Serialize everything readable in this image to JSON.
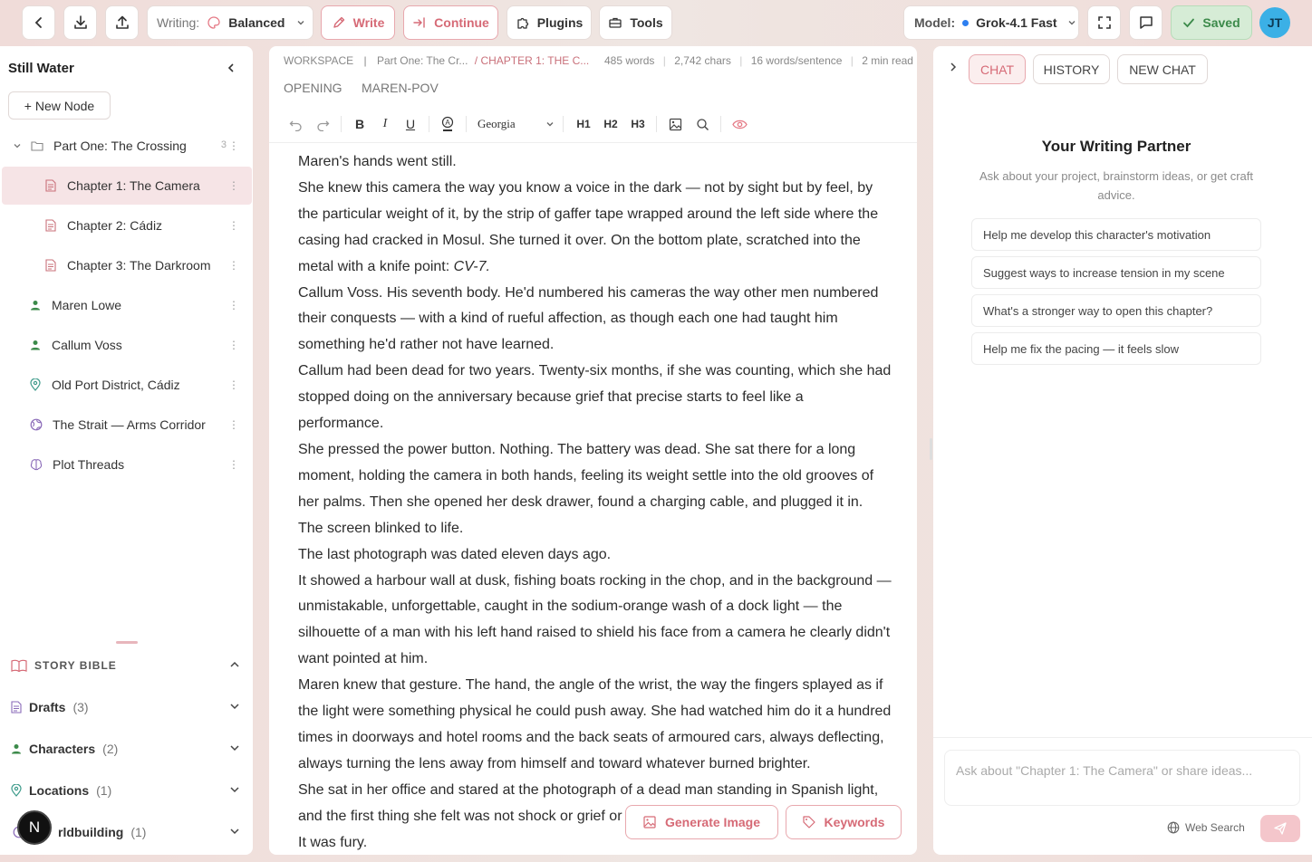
{
  "topbar": {
    "writing_label": "Writing:",
    "writing_mode": "Balanced",
    "write_label": "Write",
    "continue_label": "Continue",
    "plugins_label": "Plugins",
    "tools_label": "Tools",
    "model_label": "Model:",
    "model_value": "Grok-4.1 Fast",
    "saved_label": "Saved",
    "avatar_initials": "JT",
    "accent_color": "#e57a86",
    "saved_color": "#3c8a4a"
  },
  "sidebar": {
    "title": "Still Water",
    "new_node_label": "+ New Node",
    "items": [
      {
        "label": "Part One: The Crossing",
        "count": "3",
        "icon": "folder-icon"
      },
      {
        "label": "Chapter 1: The Camera",
        "icon": "document-icon"
      },
      {
        "label": "Chapter 2: Cádiz",
        "icon": "document-icon"
      },
      {
        "label": "Chapter 3: The Darkroom",
        "icon": "document-icon"
      },
      {
        "label": "Maren Lowe",
        "icon": "person-icon"
      },
      {
        "label": "Callum Voss",
        "icon": "person-icon"
      },
      {
        "label": "Old Port District, Cádiz",
        "icon": "location-pin-icon"
      },
      {
        "label": "The Strait — Arms Corridor",
        "icon": "globe-icon"
      },
      {
        "label": "Plot Threads",
        "icon": "brain-icon"
      }
    ],
    "story_bible": {
      "title": "STORY BIBLE",
      "sections": [
        {
          "label": "Drafts",
          "count": "(3)"
        },
        {
          "label": "Characters",
          "count": "(2)"
        },
        {
          "label": "Locations",
          "count": "(1)"
        },
        {
          "label": "rldbuilding",
          "count": "(1)"
        }
      ]
    },
    "floating_badge": "N"
  },
  "editor": {
    "breadcrumb": {
      "workspace": "WORKSPACE",
      "sep": "|",
      "part": "Part One: The Cr...",
      "chapter": "/ CHAPTER 1: THE C..."
    },
    "stats": {
      "words": "485 words",
      "chars": "2,742 chars",
      "wps": "16 words/sentence",
      "read": "2 min read"
    },
    "tabs": [
      "OPENING",
      "MAREN-POV"
    ],
    "font_name": "Georgia",
    "headings": [
      "H1",
      "H2",
      "H3"
    ],
    "paragraphs": [
      "Maren's hands went still.",
      "She knew this camera the way you know a voice in the dark — not by sight but by feel, by the particular weight of it, by the strip of gaffer tape wrapped around the left side where the casing had cracked in Mosul. She turned it over. On the bottom plate, scratched into the metal with a knife point:",
      "Callum Voss. His seventh body. He'd numbered his cameras the way other men numbered their conquests — with a kind of rueful affection, as though each one had taught him something he'd rather not have learned.",
      "Callum had been dead for two years. Twenty-six months, if she was counting, which she had stopped doing on the anniversary because grief that precise starts to feel like a performance.",
      "She pressed the power button. Nothing. The battery was dead. She sat there for a long moment, holding the camera in both hands, feeling its weight settle into the old grooves of her palms. Then she opened her desk drawer, found a charging cable, and plugged it in.",
      "The screen blinked to life.",
      "The last photograph was dated eleven days ago.",
      "It showed a harbour wall at dusk, fishing boats rocking in the chop, and in the background — unmistakable, unforgettable, caught in the sodium-orange wash of a dock light — the silhouette of a man with his left hand raised to shield his face from a camera he clearly didn't want pointed at him.",
      "Maren knew that gesture. The hand, the angle of the wrist, the way the fingers splayed as if the light were something physical he could push away. She had watched him do it a hundred times in doorways and hotel rooms and the back seats of armoured cars, always deflecting, always turning the lens away from himself and toward whatever burned brighter.",
      "She sat in her office and stared at the photograph of a dead man standing in Spanish light, and the first thing she felt was not shock or grief or",
      "It was fury."
    ],
    "italic_tail": "CV-7.",
    "generate_image_label": "Generate Image",
    "keywords_label": "Keywords"
  },
  "chat": {
    "tabs": [
      "CHAT",
      "HISTORY",
      "NEW CHAT"
    ],
    "title": "Your Writing Partner",
    "subtitle": "Ask about your project, brainstorm ideas, or get craft advice.",
    "suggestions": [
      "Help me develop this character's motivation",
      "Suggest ways to increase tension in my scene",
      "What's a stronger way to open this chapter?",
      "Help me fix the pacing — it feels slow"
    ],
    "input_placeholder": "Ask about \"Chapter 1: The Camera\" or share ideas...",
    "web_search_label": "Web Search"
  }
}
